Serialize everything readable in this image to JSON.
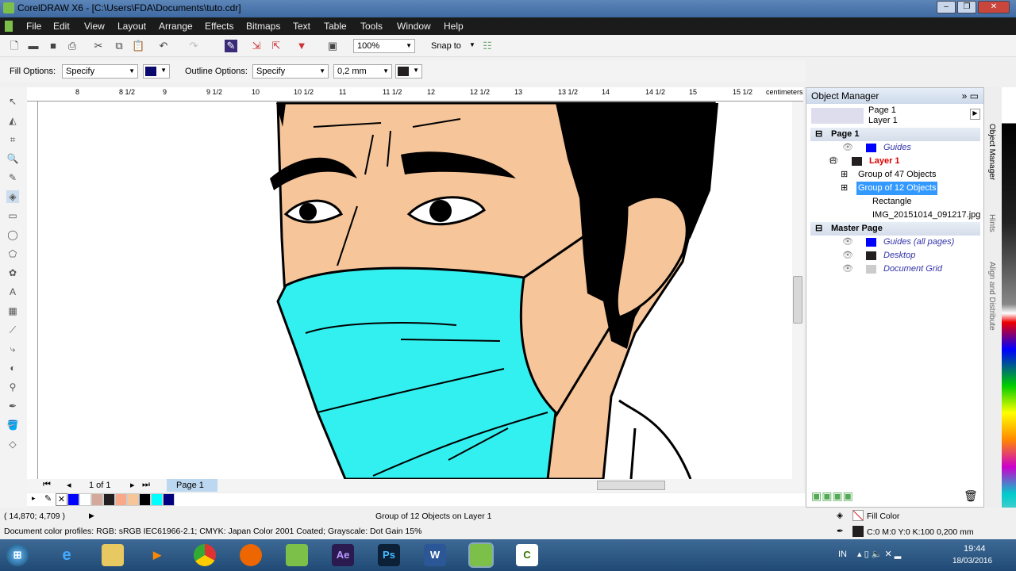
{
  "window": {
    "title": "CorelDRAW X6 - [C:\\Users\\FDA\\Documents\\tuto.cdr]"
  },
  "menu": [
    "File",
    "Edit",
    "View",
    "Layout",
    "Arrange",
    "Effects",
    "Bitmaps",
    "Text",
    "Table",
    "Tools",
    "Window",
    "Help"
  ],
  "toolbar": {
    "zoom": "100%",
    "snap": "Snap to"
  },
  "propbar": {
    "fill_label": "Fill Options:",
    "fill_value": "Specify",
    "fill_color": "#0a0a6e",
    "outline_label": "Outline Options:",
    "outline_value": "Specify",
    "outline_width": "0,2 mm",
    "outline_color": "#231f20"
  },
  "ruler": {
    "ticks": [
      "8",
      "8 1/2",
      "9",
      "9 1/2",
      "10",
      "10 1/2",
      "11",
      "11 1/2",
      "12",
      "12 1/2",
      "13",
      "13 1/2",
      "14",
      "14 1/2",
      "15",
      "15 1/2"
    ],
    "unit": "centimeters"
  },
  "pagenav": {
    "counter": "1 of 1",
    "tab": "Page 1"
  },
  "palette": [
    "#0000ff",
    "#ffffff",
    "#d4a99a",
    "#231f20",
    "#f7a98a",
    "#f6c59a",
    "#000000",
    "#00ffff",
    "#000080"
  ],
  "object_manager": {
    "title": "Object Manager",
    "page": "Page 1",
    "layer": "Layer 1",
    "rows": [
      {
        "label": "Page 1",
        "type": "section"
      },
      {
        "label": "Guides",
        "color": "#0000ff"
      },
      {
        "label": "Layer 1",
        "color": "#231f20",
        "active": true
      },
      {
        "label": "Group of 47 Objects"
      },
      {
        "label": "Group of 12 Objects",
        "selected": true
      },
      {
        "label": "Rectangle"
      },
      {
        "label": "IMG_20151014_091217.jpg"
      },
      {
        "label": "Master Page",
        "type": "section"
      },
      {
        "label": "Guides (all pages)",
        "color": "#0000ff"
      },
      {
        "label": "Desktop",
        "color": "#231f20"
      },
      {
        "label": "Document Grid",
        "color": "#cccccc"
      }
    ]
  },
  "dock_tabs": [
    "Object Manager",
    "Hints",
    "Align and Distribute"
  ],
  "status": {
    "coords": "( 14,870; 4,709 )",
    "selection": "Group of 12 Objects on Layer 1",
    "profiles": "Document color profiles: RGB: sRGB IEC61966-2.1; CMYK: Japan Color 2001 Coated; Grayscale: Dot Gain 15%",
    "fill": "Fill Color",
    "outline": "C:0 M:0 Y:0 K:100  0,200 mm"
  },
  "taskbar": {
    "apps": [
      "Internet Explorer",
      "Explorer",
      "Media Player",
      "Chrome",
      "Firefox",
      "CorelDRAW",
      "Ae",
      "Ps",
      "W",
      "CorelDRAW",
      "Camtasia"
    ],
    "lang": "IN",
    "time": "19:44",
    "date": "18/03/2016"
  }
}
